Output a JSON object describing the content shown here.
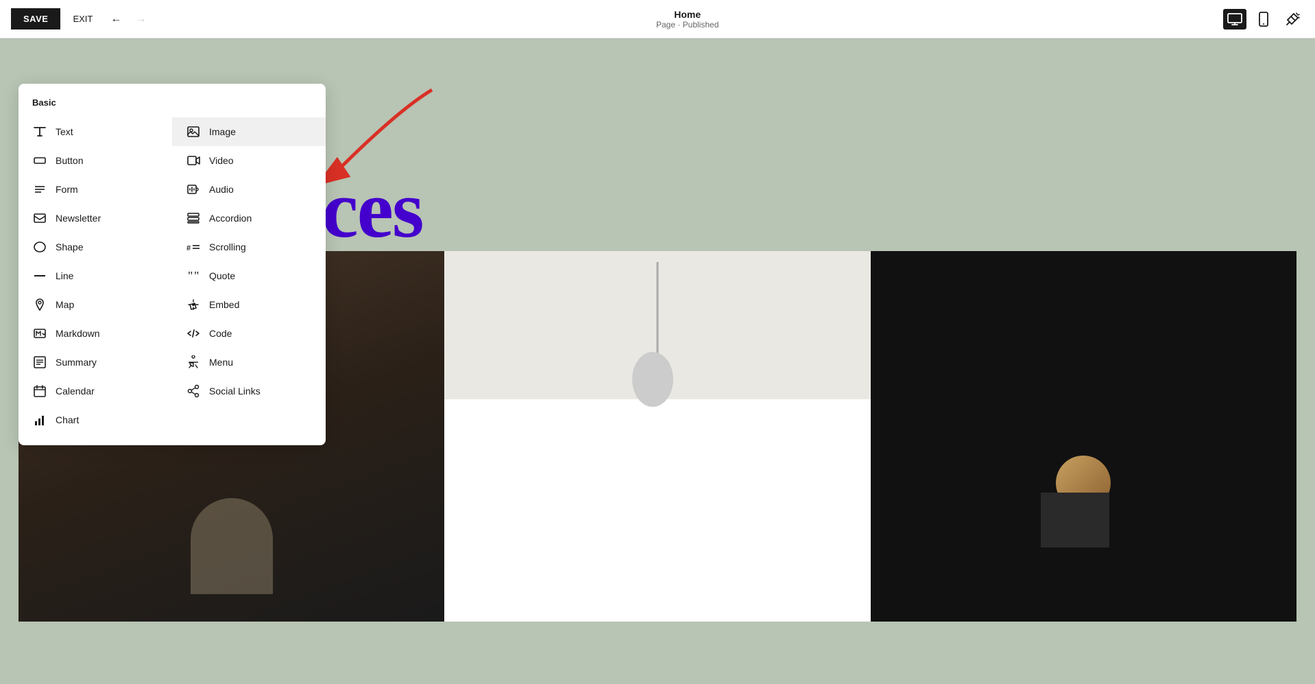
{
  "toolbar": {
    "save_label": "SAVE",
    "exit_label": "EXIT",
    "page_title": "Home",
    "page_status": "Page · Published"
  },
  "panel": {
    "section_title": "Basic",
    "items_left": [
      {
        "id": "text",
        "label": "Text",
        "icon": "text-icon"
      },
      {
        "id": "button",
        "label": "Button",
        "icon": "button-icon"
      },
      {
        "id": "form",
        "label": "Form",
        "icon": "form-icon"
      },
      {
        "id": "newsletter",
        "label": "Newsletter",
        "icon": "newsletter-icon"
      },
      {
        "id": "shape",
        "label": "Shape",
        "icon": "shape-icon"
      },
      {
        "id": "line",
        "label": "Line",
        "icon": "line-icon"
      },
      {
        "id": "map",
        "label": "Map",
        "icon": "map-icon"
      },
      {
        "id": "markdown",
        "label": "Markdown",
        "icon": "markdown-icon"
      },
      {
        "id": "summary",
        "label": "Summary",
        "icon": "summary-icon"
      },
      {
        "id": "calendar",
        "label": "Calendar",
        "icon": "calendar-icon"
      },
      {
        "id": "chart",
        "label": "Chart",
        "icon": "chart-icon"
      }
    ],
    "items_right": [
      {
        "id": "image",
        "label": "Image",
        "icon": "image-icon",
        "active": true
      },
      {
        "id": "video",
        "label": "Video",
        "icon": "video-icon"
      },
      {
        "id": "audio",
        "label": "Audio",
        "icon": "audio-icon"
      },
      {
        "id": "accordion",
        "label": "Accordion",
        "icon": "accordion-icon"
      },
      {
        "id": "scrolling",
        "label": "Scrolling",
        "icon": "scrolling-icon"
      },
      {
        "id": "quote",
        "label": "Quote",
        "icon": "quote-icon"
      },
      {
        "id": "embed",
        "label": "Embed",
        "icon": "embed-icon"
      },
      {
        "id": "code",
        "label": "Code",
        "icon": "code-icon"
      },
      {
        "id": "menu",
        "label": "Menu",
        "icon": "menu-icon"
      },
      {
        "id": "social-links",
        "label": "Social Links",
        "icon": "social-links-icon"
      }
    ]
  },
  "canvas": {
    "hero_text": "vices"
  }
}
